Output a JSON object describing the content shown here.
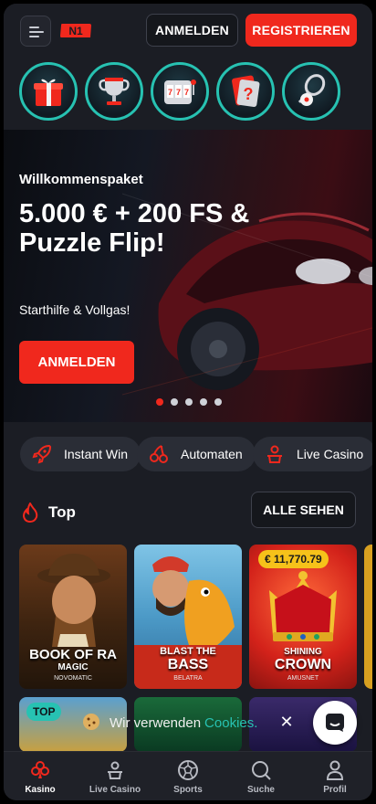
{
  "header": {
    "login_label": "ANMELDEN",
    "register_label": "REGISTRIEREN",
    "logo_text": "N1"
  },
  "stories": [
    {
      "icon": "gift-icon"
    },
    {
      "icon": "trophy-icon"
    },
    {
      "icon": "slot-machine-icon"
    },
    {
      "icon": "question-card-icon"
    },
    {
      "icon": "racket-ball-icon"
    }
  ],
  "hero": {
    "kicker": "Willkommenspaket",
    "title": "5.000 € + 200 FS & Puzzle Flip!",
    "subtitle": "Starthilfe & Vollgas!",
    "cta_label": "ANMELDEN",
    "slides_count": 5,
    "active_slide": 1
  },
  "categories": [
    {
      "label": "Instant Win",
      "icon": "rocket-icon"
    },
    {
      "label": "Automaten",
      "icon": "cherries-icon"
    },
    {
      "label": "Live Casino",
      "icon": "dealer-icon"
    }
  ],
  "top_section": {
    "title": "Top",
    "see_all_label": "ALLE SEHEN"
  },
  "games": [
    {
      "title_line1": "BOOK OF RA",
      "title_line2": "MAGIC",
      "provider": "NOVOMATIC"
    },
    {
      "title_line1": "BLAST THE",
      "title_line2": "BASS",
      "provider": "BELATRA"
    },
    {
      "title_line1": "SHINING",
      "title_line2": "CROWN",
      "provider": "AMUSNET",
      "badge": "€ 11,770.79"
    }
  ],
  "second_row": [
    {
      "badge": "TOP"
    }
  ],
  "cookie": {
    "text": "Wir verwenden",
    "link": "Cookies."
  },
  "bottom_nav": [
    {
      "label": "Kasino",
      "icon": "club-icon",
      "active": true
    },
    {
      "label": "Live Casino",
      "icon": "dealer-icon",
      "active": false
    },
    {
      "label": "Sports",
      "icon": "soccer-ball-icon",
      "active": false
    },
    {
      "label": "Suche",
      "icon": "search-icon",
      "active": false
    },
    {
      "label": "Profil",
      "icon": "user-icon",
      "active": false
    }
  ],
  "colors": {
    "accent_red": "#f0281d",
    "accent_teal": "#27c2b2",
    "background": "#1b1d24"
  }
}
